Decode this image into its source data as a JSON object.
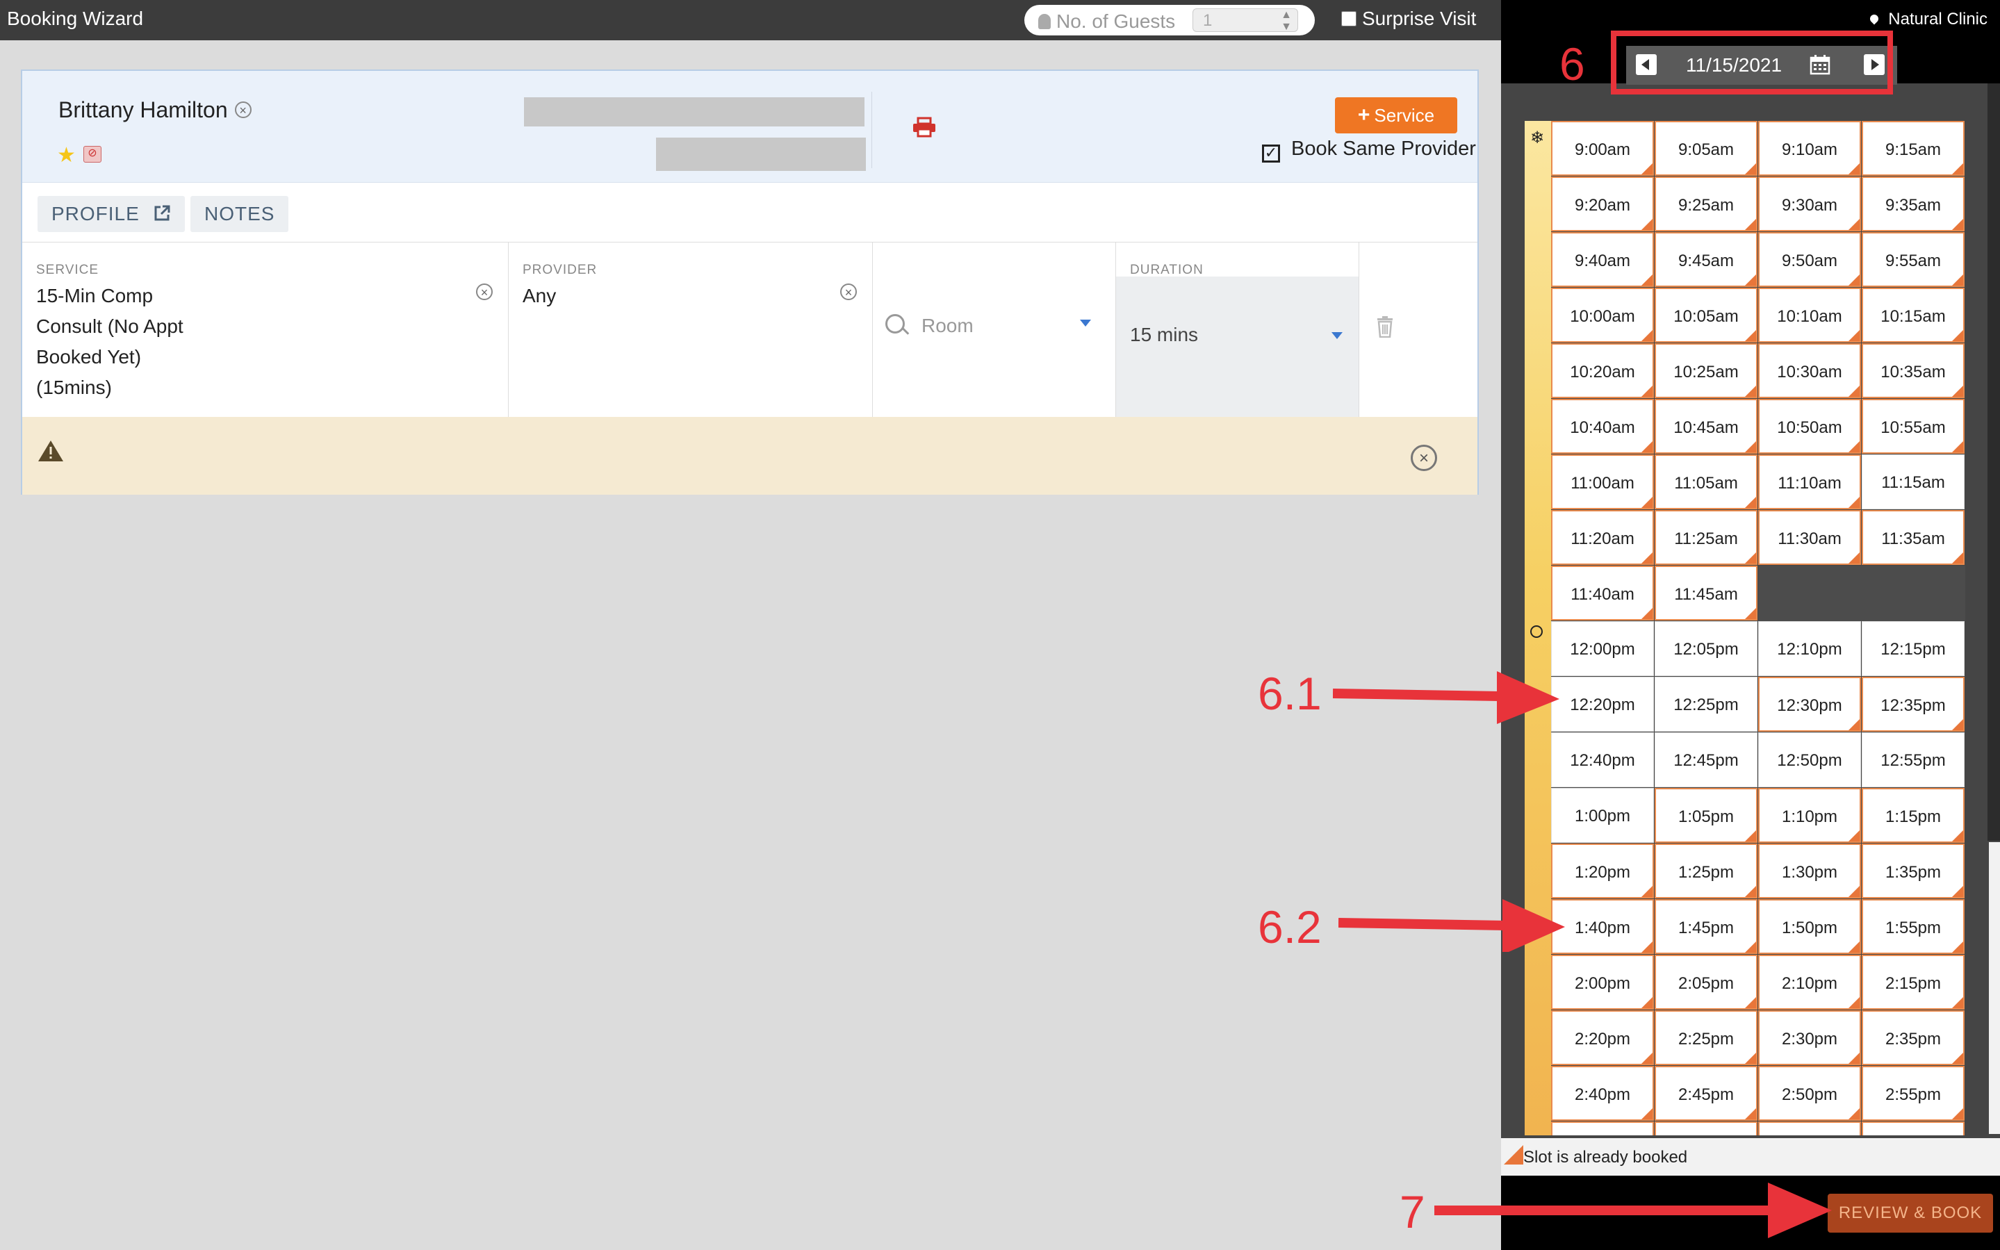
{
  "topbar": {
    "title": "Booking Wizard",
    "guests_placeholder": "No. of Guests",
    "guests_value": "1",
    "surprise_label": "Surprise Visit"
  },
  "client": {
    "name": "Brittany Hamilton"
  },
  "actions": {
    "service_label": "Service",
    "book_same_provider": "Book Same Provider"
  },
  "tabs": [
    "PROFILE",
    "NOTES"
  ],
  "booking_row": {
    "service_label": "SERVICE",
    "service_value": [
      "15-Min Comp",
      "Consult (No Appt",
      "Booked Yet)",
      "(15mins)"
    ],
    "provider_label": "PROVIDER",
    "provider_value": "Any",
    "room_placeholder": "Room",
    "duration_label": "DURATION",
    "duration_value": "15 mins"
  },
  "location": "Natural Clinic",
  "date": "11/15/2021",
  "slots": [
    [
      "9:00am",
      "9:05am",
      "9:10am",
      "9:15am"
    ],
    [
      "9:20am",
      "9:25am",
      "9:30am",
      "9:35am"
    ],
    [
      "9:40am",
      "9:45am",
      "9:50am",
      "9:55am"
    ],
    [
      "10:00am",
      "10:05am",
      "10:10am",
      "10:15am"
    ],
    [
      "10:20am",
      "10:25am",
      "10:30am",
      "10:35am"
    ],
    [
      "10:40am",
      "10:45am",
      "10:50am",
      "10:55am"
    ],
    [
      "11:00am",
      "11:05am",
      "11:10am",
      "11:15am"
    ],
    [
      "11:20am",
      "11:25am",
      "11:30am",
      "11:35am"
    ],
    [
      "11:40am",
      "11:45am"
    ],
    [
      "12:00pm",
      "12:05pm",
      "12:10pm",
      "12:15pm"
    ],
    [
      "12:20pm",
      "12:25pm",
      "12:30pm",
      "12:35pm"
    ],
    [
      "12:40pm",
      "12:45pm",
      "12:50pm",
      "12:55pm"
    ],
    [
      "1:00pm",
      "1:05pm",
      "1:10pm",
      "1:15pm"
    ],
    [
      "1:20pm",
      "1:25pm",
      "1:30pm",
      "1:35pm"
    ],
    [
      "1:40pm",
      "1:45pm",
      "1:50pm",
      "1:55pm"
    ],
    [
      "2:00pm",
      "2:05pm",
      "2:10pm",
      "2:15pm"
    ],
    [
      "2:20pm",
      "2:25pm",
      "2:30pm",
      "2:35pm"
    ],
    [
      "2:40pm",
      "2:45pm",
      "2:50pm",
      "2:55pm"
    ]
  ],
  "booked": [
    [
      "9:00am",
      "9:05am",
      "9:10am",
      "9:15am",
      "9:20am",
      "9:25am",
      "9:30am",
      "9:35am",
      "9:40am",
      "9:45am",
      "9:50am",
      "9:55am",
      "10:00am",
      "10:05am",
      "10:10am",
      "10:15am",
      "10:20am",
      "10:25am",
      "10:30am",
      "10:35am",
      "10:40am",
      "10:45am",
      "10:50am",
      "10:55am",
      "11:00am",
      "11:05am",
      "11:10am",
      "11:20am",
      "11:25am",
      "11:30am",
      "11:35am",
      "11:40am",
      "11:45am",
      "12:30pm",
      "12:35pm",
      "1:05pm",
      "1:10pm",
      "1:15pm",
      "1:20pm",
      "1:25pm",
      "1:30pm",
      "1:35pm",
      "1:40pm",
      "1:45pm",
      "1:50pm",
      "1:55pm",
      "2:00pm",
      "2:05pm",
      "2:10pm",
      "2:15pm",
      "2:20pm",
      "2:25pm",
      "2:30pm",
      "2:35pm",
      "2:40pm",
      "2:45pm",
      "2:50pm",
      "2:55pm"
    ]
  ],
  "legend": "Slot is already booked",
  "review_button": "REVIEW & BOOK",
  "annotations": {
    "date_nav": "6",
    "slot_a": "6.1",
    "slot_b": "6.2",
    "review": "7"
  },
  "colors": {
    "accent_orange": "#ef7623",
    "annotation_red": "#e8333a",
    "booked_marker": "#e8763a"
  }
}
